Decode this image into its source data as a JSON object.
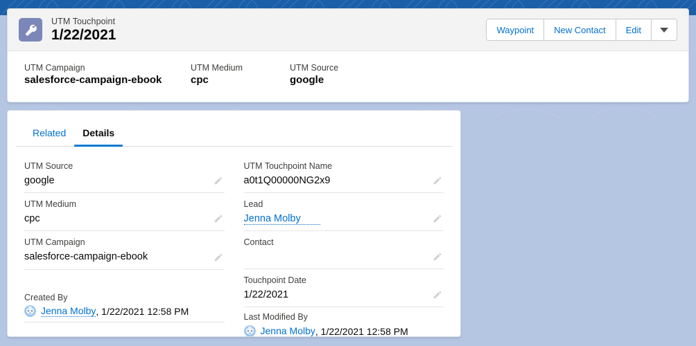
{
  "theme": {
    "background_color": "#b5c6e3",
    "top_strip_color": "#1b5fa8",
    "link_color": "#0070d2",
    "active_tab_underline": "#0b7ad1",
    "record_icon_color": "#7a87b8",
    "header_band_color": "#f3f3f3"
  },
  "record_header": {
    "icon": "wrench-icon",
    "type_label": "UTM Touchpoint",
    "record_name": "1/22/2021",
    "actions": [
      {
        "label": "Waypoint",
        "name": "waypoint-button"
      },
      {
        "label": "New Contact",
        "name": "new-contact-button"
      },
      {
        "label": "Edit",
        "name": "edit-button"
      }
    ],
    "more_actions_icon": "chevron-down-icon"
  },
  "highlight_fields": [
    {
      "label": "UTM Campaign",
      "value": "salesforce-campaign-ebook"
    },
    {
      "label": "UTM Medium",
      "value": "cpc"
    },
    {
      "label": "UTM Source",
      "value": "google"
    }
  ],
  "tabs": [
    {
      "label": "Related",
      "active": false
    },
    {
      "label": "Details",
      "active": true
    }
  ],
  "details": {
    "left_column": [
      {
        "label": "UTM Source",
        "value": "google",
        "type": "text"
      },
      {
        "label": "UTM Medium",
        "value": "cpc",
        "type": "text"
      },
      {
        "label": "UTM Campaign",
        "value": "salesforce-campaign-ebook",
        "type": "text"
      }
    ],
    "right_column": [
      {
        "label": "UTM Touchpoint Name",
        "value": "a0t1Q00000NG2x9",
        "type": "text"
      },
      {
        "label": "Lead",
        "value": "Jenna Molby",
        "type": "link"
      },
      {
        "label": "Contact",
        "value": "",
        "type": "text"
      },
      {
        "label": "Touchpoint Date",
        "value": "1/22/2021",
        "type": "text"
      }
    ]
  },
  "system_info": {
    "created_by": {
      "label": "Created By",
      "avatar": "user-avatar",
      "user": "Jenna Molby",
      "timestamp": ", 1/22/2021 12:58 PM"
    },
    "last_modified_by": {
      "label": "Last Modified By",
      "avatar": "user-avatar",
      "user": "Jenna Molby",
      "timestamp": ", 1/22/2021 12:58 PM"
    }
  },
  "icons": {
    "edit_pencil": "pencil-icon"
  }
}
